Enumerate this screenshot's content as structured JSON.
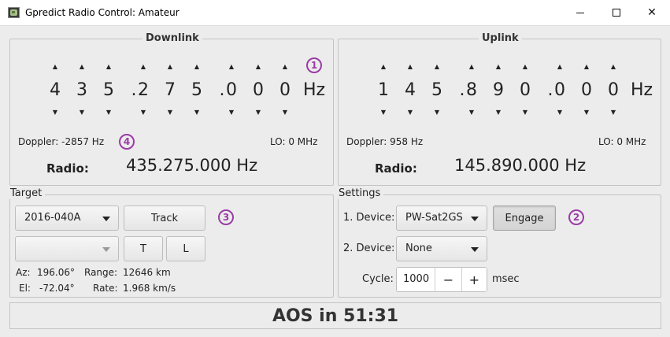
{
  "window": {
    "title": "Gpredict Radio Control: Amateur",
    "minimize_glyph": "",
    "close_glyph": "✕"
  },
  "downlink": {
    "label": "Downlink",
    "digits": [
      "4",
      "3",
      "5",
      ".",
      "2",
      "7",
      "5",
      ".",
      "0",
      "0",
      "0"
    ],
    "unit": "Hz",
    "doppler": "Doppler: -2857 Hz",
    "lo": "LO: 0 MHz",
    "radio_label": "Radio:",
    "radio_freq": "435.275.000 Hz"
  },
  "uplink": {
    "label": "Uplink",
    "digits": [
      "1",
      "4",
      "5",
      ".",
      "8",
      "9",
      "0",
      ".",
      "0",
      "0",
      "0"
    ],
    "unit": "Hz",
    "doppler": "Doppler: 958 Hz",
    "lo": "LO: 0 MHz",
    "radio_label": "Radio:",
    "radio_freq": "145.890.000 Hz"
  },
  "target": {
    "label": "Target",
    "satellite": "2016-040A",
    "pass_combo": "",
    "track_label": "Track",
    "t_label": "T",
    "l_label": "L",
    "az_label": "Az:",
    "az_value": "196.06°",
    "range_label": "Range:",
    "range_value": "12646 km",
    "el_label": "El:",
    "el_value": "-72.04°",
    "rate_label": "Rate:",
    "rate_value": "1.968 km/s"
  },
  "settings": {
    "label": "Settings",
    "device1_label": "1. Device:",
    "device1_value": "PW-Sat2GS",
    "engage_label": "Engage",
    "device2_label": "2. Device:",
    "device2_value": "None",
    "cycle_label": "Cycle:",
    "cycle_value": "1000",
    "minus": "−",
    "plus": "+",
    "cycle_unit": "msec"
  },
  "status": {
    "text": "AOS in 51:31"
  },
  "annotations": [
    "1",
    "2",
    "3",
    "4"
  ],
  "colors": {
    "annotation": "#9a3ca6",
    "background": "#ececec"
  }
}
